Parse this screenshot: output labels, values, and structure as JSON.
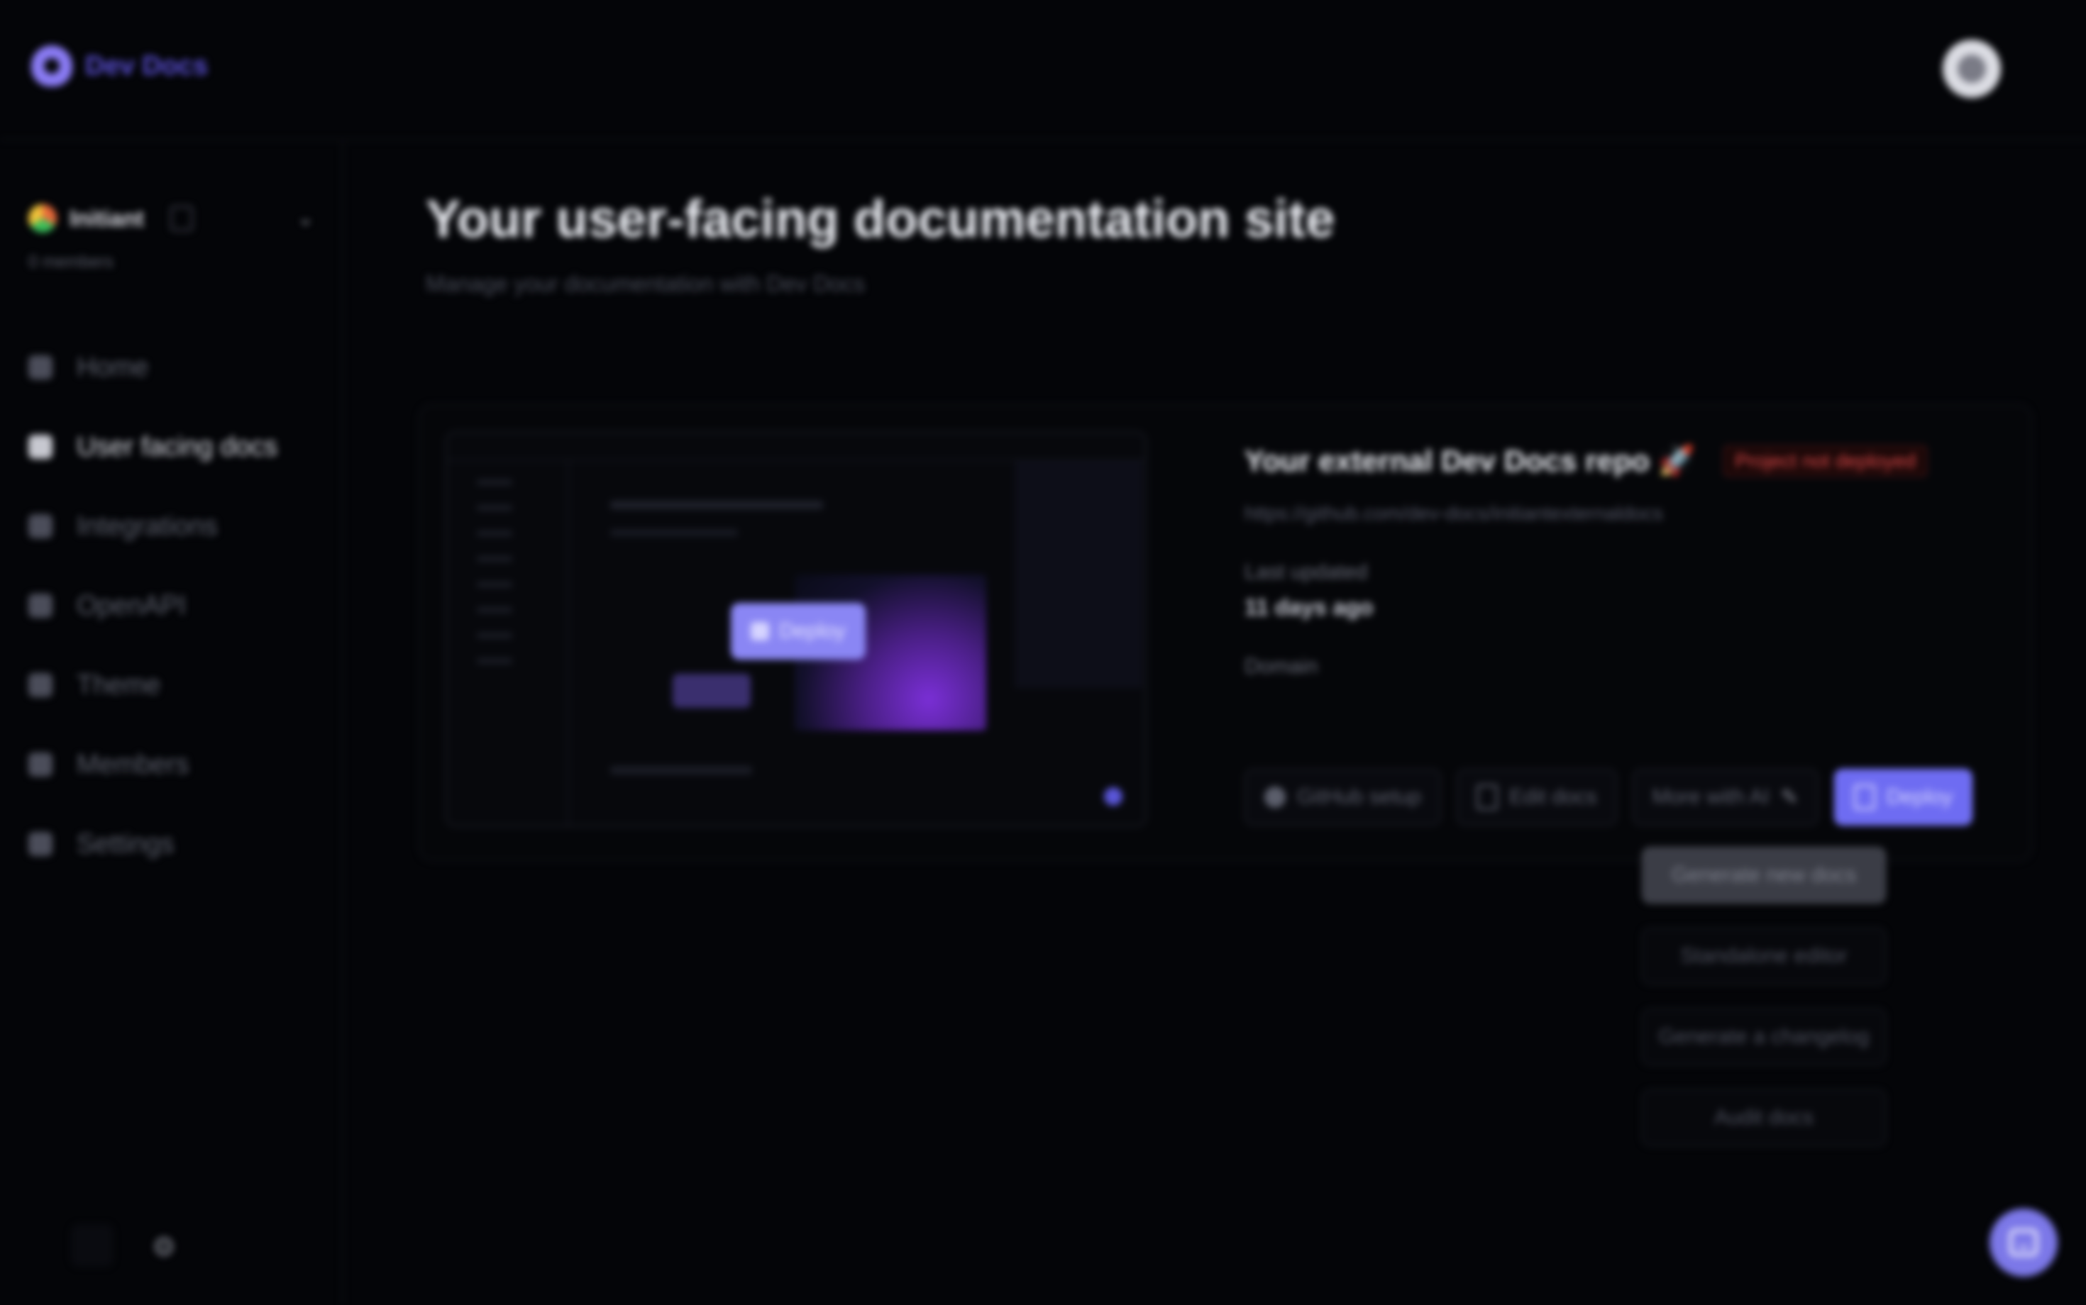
{
  "app": {
    "brand": "Dev Docs",
    "accent": "#6e6cf2"
  },
  "sidebar": {
    "org_name": "Initiant",
    "org_subtitle": "0 members",
    "items": [
      {
        "label": "Home",
        "icon": "home-icon",
        "active": false
      },
      {
        "label": "User facing docs",
        "icon": "docs-icon",
        "active": true
      },
      {
        "label": "Integrations",
        "icon": "integrations-icon",
        "active": false
      },
      {
        "label": "OpenAPI",
        "icon": "openapi-icon",
        "active": false
      },
      {
        "label": "Theme",
        "icon": "theme-icon",
        "active": false
      },
      {
        "label": "Members",
        "icon": "members-icon",
        "active": false
      },
      {
        "label": "Settings",
        "icon": "settings-icon",
        "active": false
      }
    ]
  },
  "main": {
    "title": "Your user-facing documentation site",
    "subtitle": "Manage your documentation with Dev Docs"
  },
  "card": {
    "repo_title": "Your external Dev Docs repo",
    "repo_emoji": "🚀",
    "badge": "Project not deployed",
    "repo_url": "https://github.com/dev-docs/initiantexternaldocs",
    "last_updated_label": "Last updated",
    "last_updated_value": "11 days ago",
    "domain_label": "Domain",
    "preview_button": "Deploy",
    "actions": {
      "github_setup": "GitHub setup",
      "edit_docs": "Edit docs",
      "more_with_ai": "More with AI",
      "deploy": "Deploy"
    }
  },
  "dropdown": {
    "items": [
      {
        "label": "Generate new docs",
        "highlighted": true
      },
      {
        "label": "Standalone editor",
        "highlighted": false
      },
      {
        "label": "Generate a changelog",
        "highlighted": false
      },
      {
        "label": "Audit docs",
        "highlighted": false
      }
    ]
  }
}
